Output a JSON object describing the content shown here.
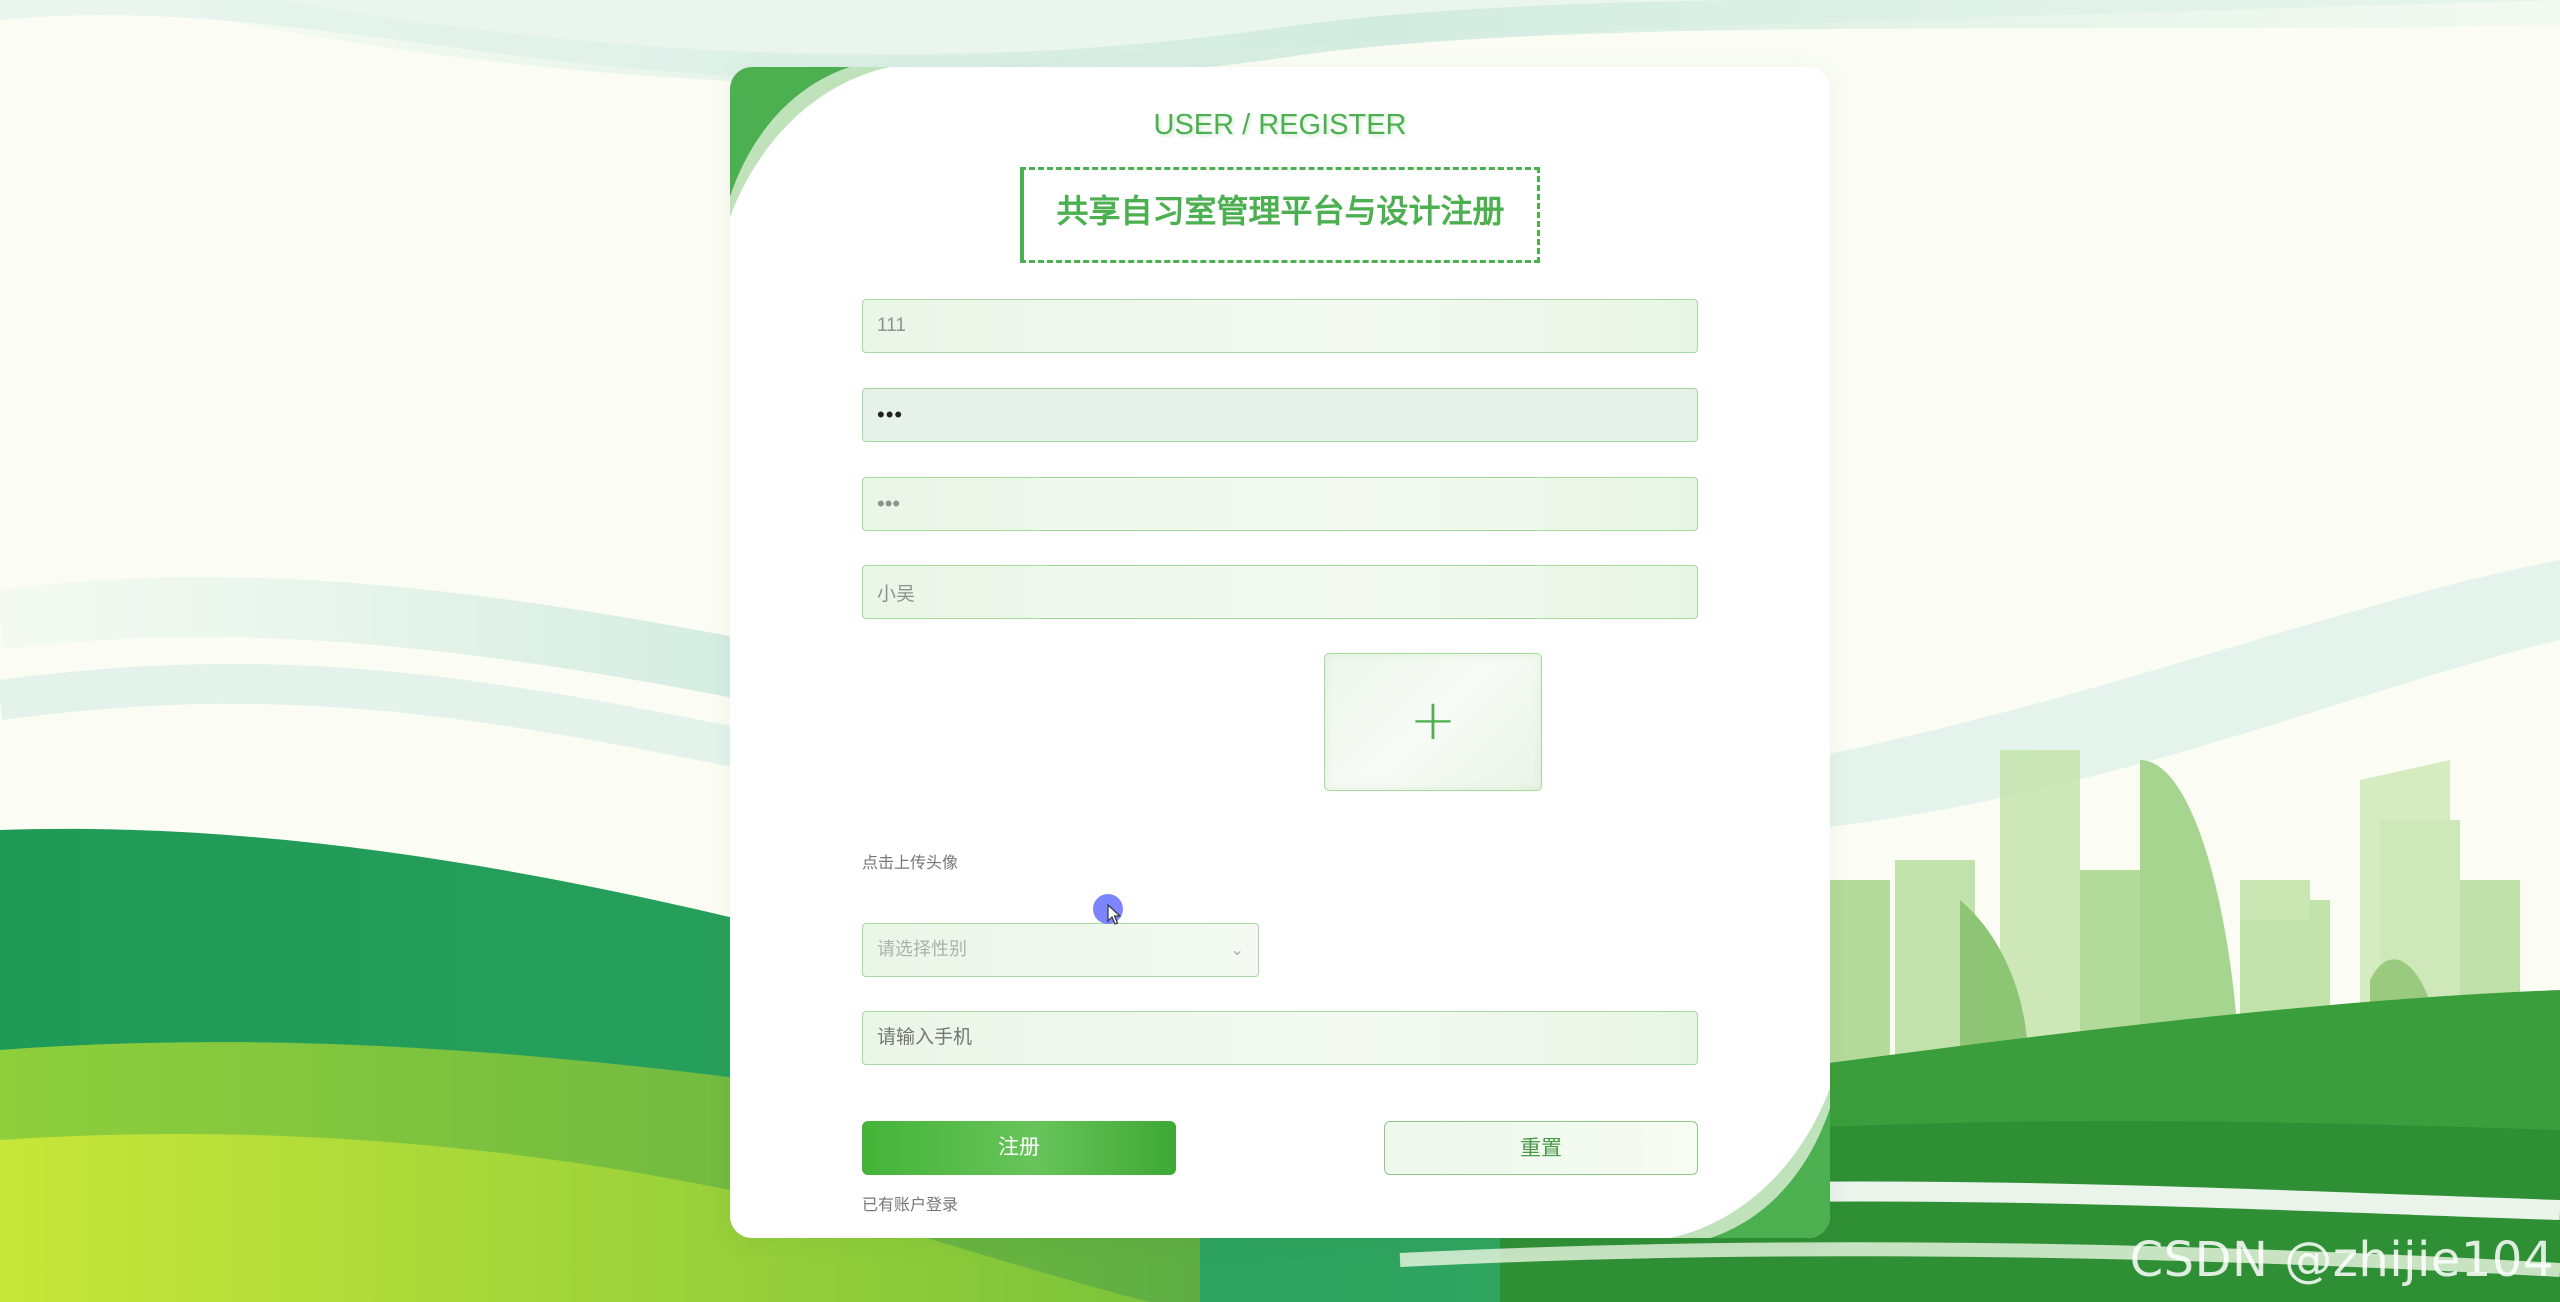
{
  "header": {
    "subtitle": "USER / REGISTER",
    "title": "共享自习室管理平台与设计注册"
  },
  "form": {
    "username_value": "111",
    "password_value": "•••",
    "confirm_password_value": "•••",
    "name_value": "小吴",
    "avatar_hint": "点击上传头像",
    "gender_placeholder": "请选择性别",
    "phone_placeholder": "请输入手机"
  },
  "buttons": {
    "register_label": "注册",
    "reset_label": "重置",
    "login_link": "已有账户登录"
  },
  "icons": {
    "upload": "plus-icon",
    "select": "chevron-down-icon"
  },
  "watermark": "CSDN @zhijie104",
  "colors": {
    "accent": "#4caf50",
    "field_border": "#a8d8a2",
    "register_button": "#44b338"
  }
}
